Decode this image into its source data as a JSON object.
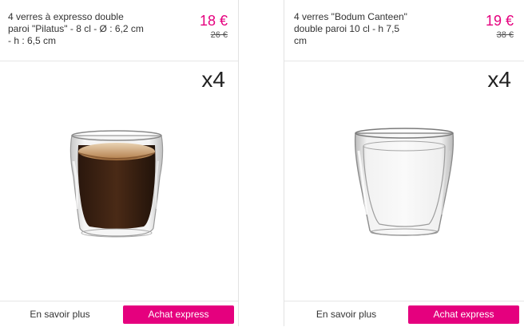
{
  "products": [
    {
      "title": "4 verres à expresso double paroi \"Pilatus\" - 8 cl - Ø : 6,2 cm - h : 6,5 cm",
      "price": "18 €",
      "old_price": "26 €",
      "quantity": "x4",
      "image": "espresso-double-wall-glass-with-coffee",
      "more_label": "En savoir plus",
      "buy_label": "Achat express"
    },
    {
      "title": "4 verres \"Bodum Canteen\" double paroi 10 cl - h 7,5 cm",
      "price": "19 €",
      "old_price": "38 €",
      "quantity": "x4",
      "image": "empty-double-wall-glass",
      "more_label": "En savoir plus",
      "buy_label": "Achat express"
    }
  ],
  "colors": {
    "accent": "#e5007e",
    "border": "#e2e2e2",
    "text": "#333333"
  }
}
